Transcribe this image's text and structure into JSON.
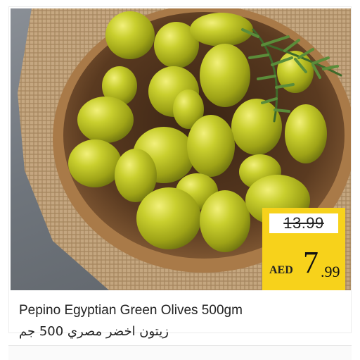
{
  "product": {
    "name_en": "Pepino Egyptian Green Olives 500gm",
    "name_ar": "زيتون اخضر مصري 500 جم"
  },
  "price": {
    "old": "13.99",
    "currency": "AED",
    "main": "7",
    "decimal": ".99"
  },
  "colors": {
    "price_tag": "#f7d21b",
    "olive": "#b8bf2a"
  },
  "image": {
    "icon": "olives-bowl-photo"
  }
}
